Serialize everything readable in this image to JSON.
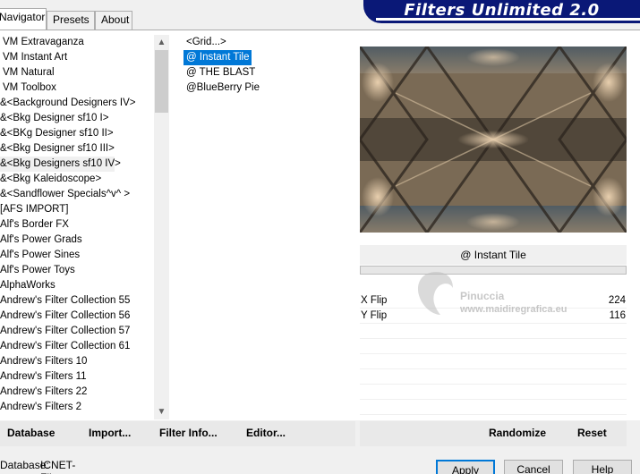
{
  "tabs": [
    {
      "label": "Navigator"
    },
    {
      "label": "Presets"
    },
    {
      "label": "About"
    }
  ],
  "banner": {
    "title": "Filters Unlimited 2.0"
  },
  "categories": [
    "VM Extravaganza",
    "VM Instant Art",
    "VM Natural",
    "VM Toolbox",
    "&<Background Designers IV>",
    "&<Bkg Designer sf10 I>",
    "&<BKg Designer sf10 II>",
    "&<Bkg Designer sf10 III>",
    "&<Bkg Designers sf10 IV>",
    "&<Bkg Kaleidoscope>",
    "&<Sandflower Specials^v^ >",
    "[AFS IMPORT]",
    "Alf's Border FX",
    "Alf's Power Grads",
    "Alf's Power Sines",
    "Alf's Power Toys",
    "AlphaWorks",
    "Andrew's Filter Collection 55",
    "Andrew's Filter Collection 56",
    "Andrew's Filter Collection 57",
    "Andrew's Filter Collection 61",
    "Andrew's Filters 10",
    "Andrew's Filters 11",
    "Andrew's Filters 22",
    "Andrew's Filters 2"
  ],
  "filters": [
    "<Grid...>",
    "@ Instant Tile",
    "@ THE BLAST",
    "@BlueBerry Pie"
  ],
  "selected_filter": "@ Instant Tile",
  "params": [
    {
      "label": "X Flip",
      "value": "224"
    },
    {
      "label": "Y Flip",
      "value": "116"
    }
  ],
  "watermark": {
    "line1": "Pinuccia",
    "line2": "www.maidiregrafica.eu"
  },
  "toolbar": {
    "database": "Database",
    "import": "Import...",
    "filter_info": "Filter Info...",
    "editor": "Editor...",
    "randomize": "Randomize",
    "reset": "Reset"
  },
  "status": {
    "label": "Database:",
    "value": "ICNET-Filters"
  },
  "dialog": {
    "apply": "Apply",
    "cancel": "Cancel",
    "help": "Help"
  },
  "icons": {
    "scroll_up": "▲",
    "scroll_down": "▼"
  }
}
